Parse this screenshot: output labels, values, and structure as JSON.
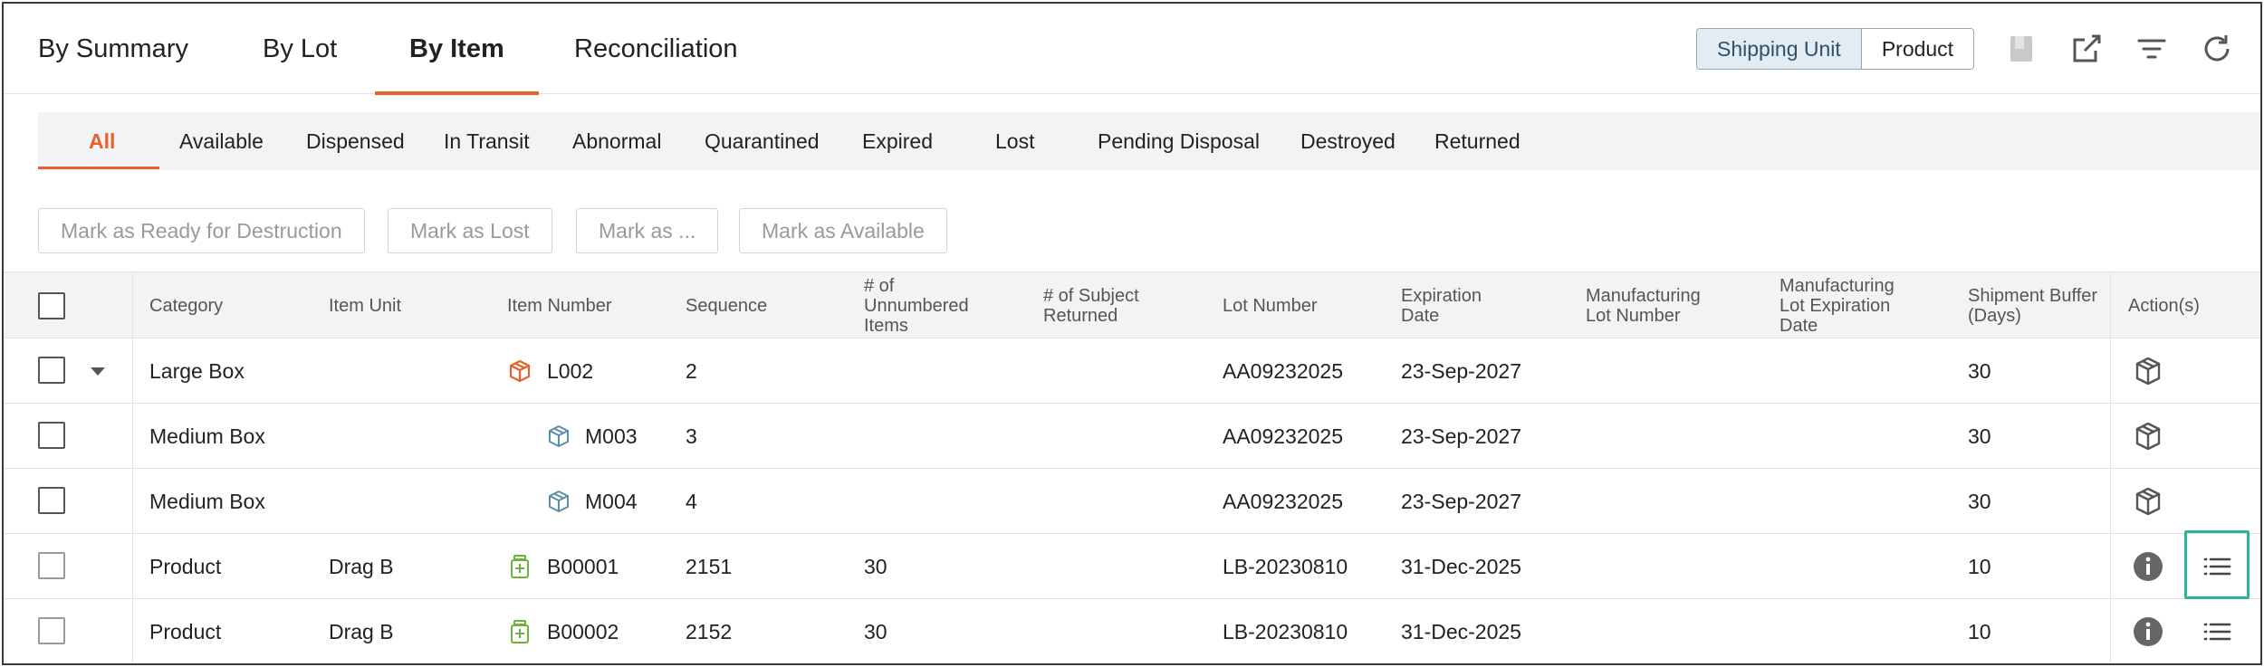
{
  "main_tabs": [
    {
      "label": "By Summary"
    },
    {
      "label": "By Lot"
    },
    {
      "label": "By Item"
    },
    {
      "label": "Reconciliation"
    }
  ],
  "view_toggle": {
    "shipping_unit": "Shipping Unit",
    "product": "Product",
    "selected": "Shipping Unit"
  },
  "toolbar_icons": [
    "bookmark-icon",
    "open-external-icon",
    "filter-icon",
    "refresh-icon"
  ],
  "status_tabs": [
    {
      "label": "All"
    },
    {
      "label": "Available"
    },
    {
      "label": "Dispensed"
    },
    {
      "label": "In Transit"
    },
    {
      "label": "Abnormal"
    },
    {
      "label": "Quarantined"
    },
    {
      "label": "Expired"
    },
    {
      "label": "Lost"
    },
    {
      "label": "Pending Disposal"
    },
    {
      "label": "Destroyed"
    },
    {
      "label": "Returned"
    }
  ],
  "actions": [
    {
      "label": "Mark as Ready for Destruction"
    },
    {
      "label": "Mark as Lost"
    },
    {
      "label": "Mark as ..."
    },
    {
      "label": "Mark as Available"
    }
  ],
  "columns": [
    {
      "line1": "Category",
      "line2": "",
      "line3": ""
    },
    {
      "line1": "Item Unit",
      "line2": "",
      "line3": ""
    },
    {
      "line1": "Item Number",
      "line2": "",
      "line3": ""
    },
    {
      "line1": "Sequence",
      "line2": "",
      "line3": ""
    },
    {
      "line1": "# of",
      "line2": "Unnumbered",
      "line3": "Items"
    },
    {
      "line1": "# of Subject",
      "line2": "Returned",
      "line3": ""
    },
    {
      "line1": "Lot Number",
      "line2": "",
      "line3": ""
    },
    {
      "line1": "Expiration",
      "line2": "Date",
      "line3": ""
    },
    {
      "line1": "Manufacturing",
      "line2": "Lot Number",
      "line3": ""
    },
    {
      "line1": "Manufacturing",
      "line2": "Lot Expiration",
      "line3": "Date"
    },
    {
      "line1": "Shipment Buffer",
      "line2": "(Days)",
      "line3": ""
    },
    {
      "line1": "Action(s)",
      "line2": "",
      "line3": ""
    }
  ],
  "rows": [
    {
      "category": "Large Box",
      "item_unit": "",
      "item_number": "L002",
      "sequence": "2",
      "unnumbered": "",
      "returned": "",
      "lot_number": "AA09232025",
      "expiration": "23-Sep-2027",
      "mfg_lot": "",
      "mfg_exp": "",
      "buffer": "30",
      "icon": "large-box-icon",
      "action": "package-icon"
    },
    {
      "category": "Medium Box",
      "item_unit": "",
      "item_number": "M003",
      "sequence": "3",
      "unnumbered": "",
      "returned": "",
      "lot_number": "AA09232025",
      "expiration": "23-Sep-2027",
      "mfg_lot": "",
      "mfg_exp": "",
      "buffer": "30",
      "icon": "medium-box-icon",
      "action": "package-icon"
    },
    {
      "category": "Medium Box",
      "item_unit": "",
      "item_number": "M004",
      "sequence": "4",
      "unnumbered": "",
      "returned": "",
      "lot_number": "AA09232025",
      "expiration": "23-Sep-2027",
      "mfg_lot": "",
      "mfg_exp": "",
      "buffer": "30",
      "icon": "medium-box-icon",
      "action": "package-icon"
    },
    {
      "category": "Product",
      "item_unit": "Drag B",
      "item_number": "B00001",
      "sequence": "2151",
      "unnumbered": "30",
      "returned": "",
      "lot_number": "LB-20230810",
      "expiration": "31-Dec-2025",
      "mfg_lot": "",
      "mfg_exp": "",
      "buffer": "10",
      "icon": "medicine-bottle-icon",
      "action": "info-icon"
    },
    {
      "category": "Product",
      "item_unit": "Drag B",
      "item_number": "B00002",
      "sequence": "2152",
      "unnumbered": "30",
      "returned": "",
      "lot_number": "LB-20230810",
      "expiration": "31-Dec-2025",
      "mfg_lot": "",
      "mfg_exp": "",
      "buffer": "10",
      "icon": "medicine-bottle-icon",
      "action": "info-icon"
    }
  ],
  "colors": {
    "accent": "#e8602c",
    "large_box": "#e8602c",
    "medium_box": "#5d8fa8",
    "product": "#6bb33a",
    "highlight": "#2bb39a"
  }
}
